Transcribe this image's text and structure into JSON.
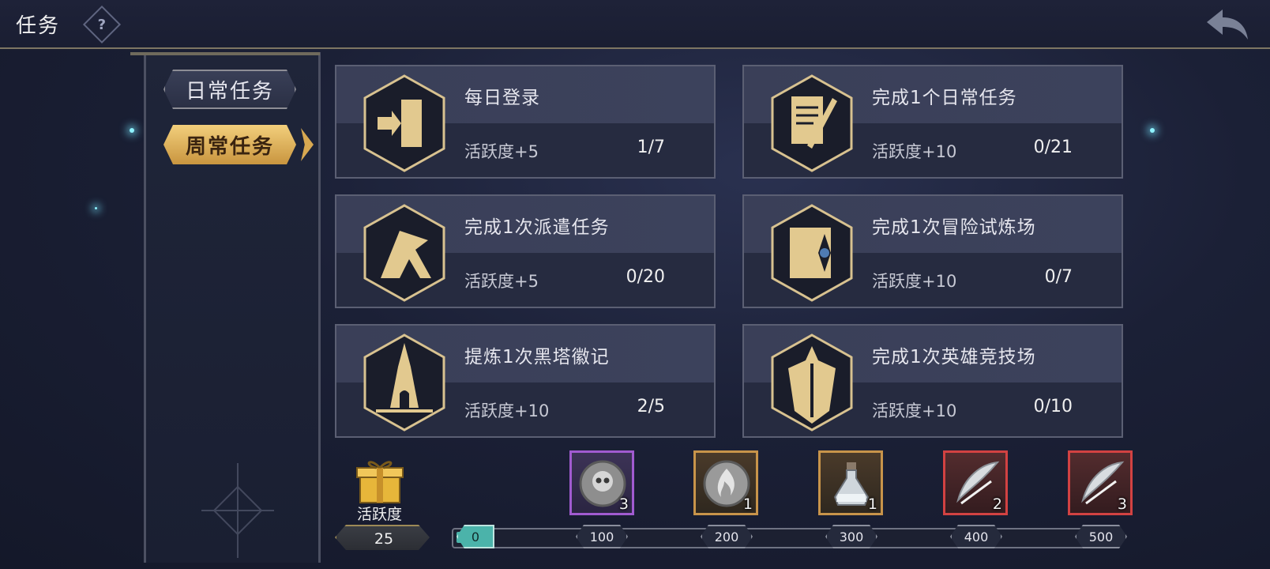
{
  "header": {
    "title": "任务",
    "help_icon": "?"
  },
  "sidebar": {
    "tabs": [
      {
        "label": "日常任务",
        "selected": false
      },
      {
        "label": "周常任务",
        "selected": true
      }
    ]
  },
  "tasks": [
    {
      "name": "每日登录",
      "points": "活跃度+5",
      "progress": "1/7",
      "icon": "login-door-icon"
    },
    {
      "name": "完成1个日常任务",
      "points": "活跃度+10",
      "progress": "0/21",
      "icon": "scroll-sword-icon"
    },
    {
      "name": "完成1次派遣任务",
      "points": "活跃度+5",
      "progress": "0/20",
      "icon": "flag-tent-icon"
    },
    {
      "name": "完成1次冒险试炼场",
      "points": "活跃度+10",
      "progress": "0/7",
      "icon": "compass-map-icon"
    },
    {
      "name": "提炼1次黑塔徽记",
      "points": "活跃度+10",
      "progress": "2/5",
      "icon": "black-tower-icon"
    },
    {
      "name": "完成1次英雄竞技场",
      "points": "活跃度+10",
      "progress": "0/10",
      "icon": "hero-arena-icon"
    }
  ],
  "activity": {
    "label": "活跃度",
    "value": "25",
    "progress_fraction": 0.05,
    "milestones": [
      "0",
      "100",
      "200",
      "300",
      "400",
      "500"
    ],
    "rewards": [
      {
        "quantity": "3",
        "rarity": "purple",
        "icon": "skull-coin-icon"
      },
      {
        "quantity": "1",
        "rarity": "orange",
        "icon": "flame-stone-icon"
      },
      {
        "quantity": "1",
        "rarity": "orange",
        "icon": "potion-bottle-icon"
      },
      {
        "quantity": "2",
        "rarity": "red",
        "icon": "feather-quill-icon"
      },
      {
        "quantity": "3",
        "rarity": "red",
        "icon": "feather-quill-icon"
      }
    ]
  },
  "colors": {
    "accent_gold": "#d7a851",
    "progress_teal": "#4bb3aa",
    "rarity_purple": "#a15bd0",
    "rarity_orange": "#c8944a",
    "rarity_red": "#d24242"
  }
}
